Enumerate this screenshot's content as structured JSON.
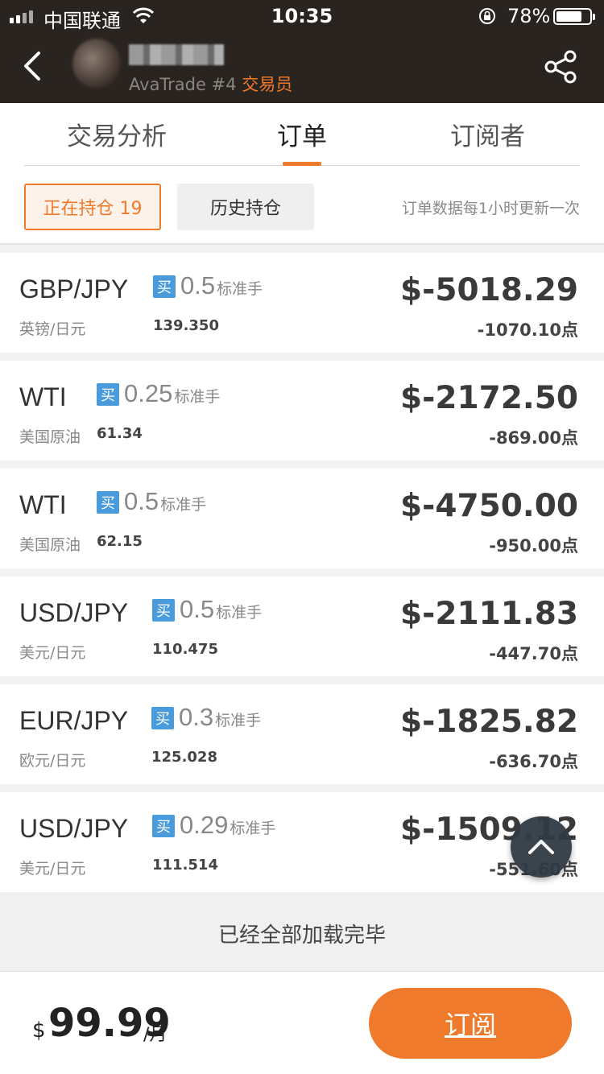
{
  "status_bar": {
    "carrier": "中国联通",
    "time": "10:35",
    "battery_pct": "78%",
    "battery_level": 0.78
  },
  "header": {
    "platform": "AvaTrade #4",
    "role": "交易员"
  },
  "tabs": [
    {
      "label": "交易分析"
    },
    {
      "label": "订单"
    },
    {
      "label": "订阅者"
    }
  ],
  "filters": {
    "holding_label": "正在持仓 19",
    "history_label": "历史持仓",
    "update_note": "订单数据每1小时更新一次"
  },
  "orders": [
    {
      "symbol": "GBP/JPY",
      "side": "买",
      "lots": "0.5",
      "unit": "标准手",
      "name": "英镑/日元",
      "price": "139.350",
      "pnl": "$-5018.29",
      "points": "-1070.10点"
    },
    {
      "symbol": "WTI",
      "side": "买",
      "lots": "0.25",
      "unit": "标准手",
      "name": "美国原油",
      "price": "61.34",
      "pnl": "$-2172.50",
      "points": "-869.00点"
    },
    {
      "symbol": "WTI",
      "side": "买",
      "lots": "0.5",
      "unit": "标准手",
      "name": "美国原油",
      "price": "62.15",
      "pnl": "$-4750.00",
      "points": "-950.00点"
    },
    {
      "symbol": "USD/JPY",
      "side": "买",
      "lots": "0.5",
      "unit": "标准手",
      "name": "美元/日元",
      "price": "110.475",
      "pnl": "$-2111.83",
      "points": "-447.70点"
    },
    {
      "symbol": "EUR/JPY",
      "side": "买",
      "lots": "0.3",
      "unit": "标准手",
      "name": "欧元/日元",
      "price": "125.028",
      "pnl": "$-1825.82",
      "points": "-636.70点"
    },
    {
      "symbol": "USD/JPY",
      "side": "买",
      "lots": "0.29",
      "unit": "标准手",
      "name": "美元/日元",
      "price": "111.514",
      "pnl": "$-1509.12",
      "points": "-551.60点"
    }
  ],
  "footer_loaded": "已经全部加载完毕",
  "subscription": {
    "currency_symbol": "$",
    "price": "99.99",
    "period": "/月",
    "button_label": "订阅"
  },
  "colors": {
    "accent": "#f07a2c",
    "buy_badge": "#4a9bdc",
    "header_bg": "#2a2421"
  }
}
